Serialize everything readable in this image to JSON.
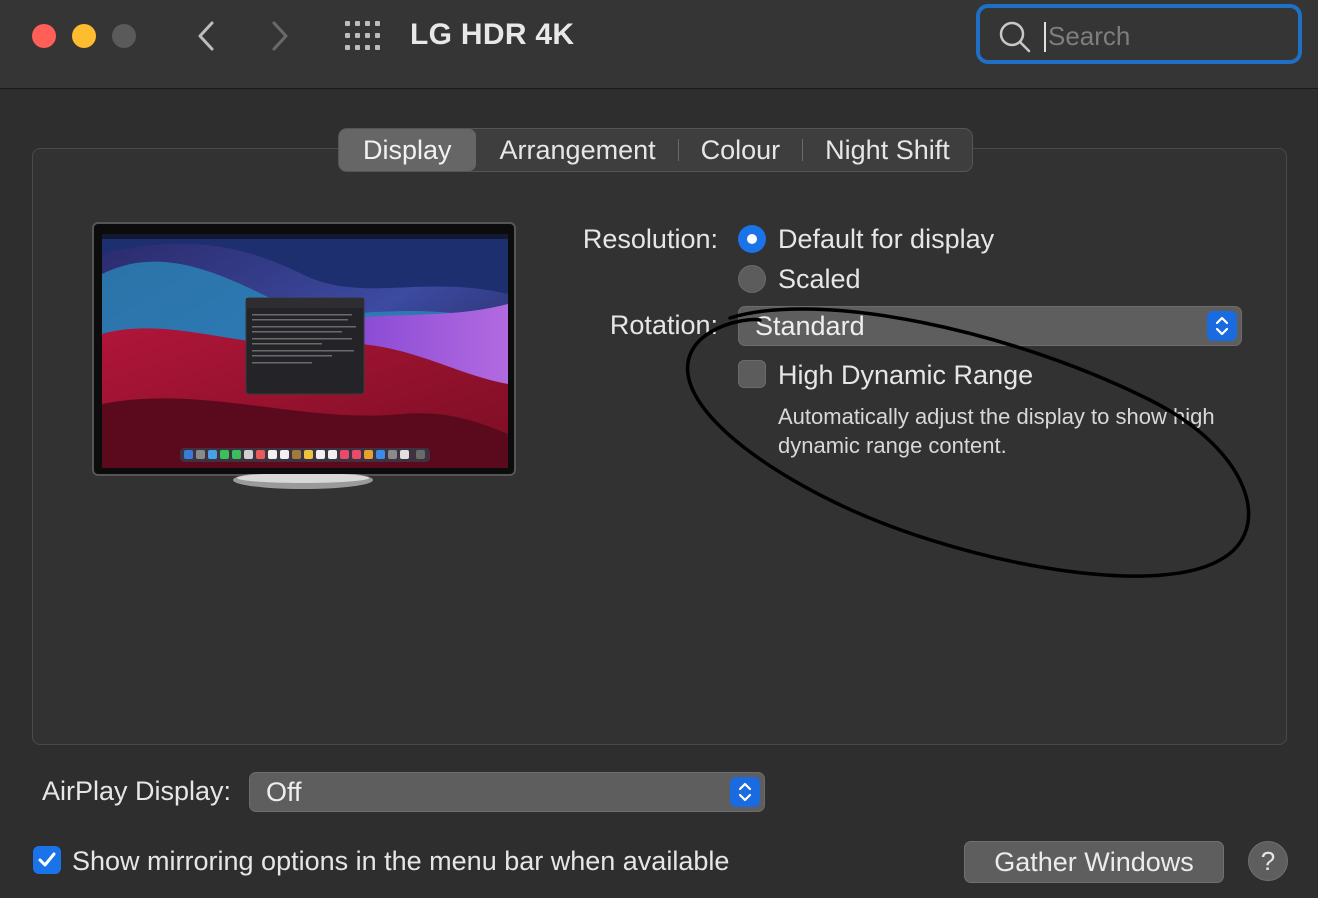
{
  "window": {
    "title": "LG HDR 4K",
    "search_placeholder": "Search"
  },
  "tabs": [
    {
      "label": "Display",
      "active": true
    },
    {
      "label": "Arrangement",
      "active": false
    },
    {
      "label": "Colour",
      "active": false
    },
    {
      "label": "Night Shift",
      "active": false
    }
  ],
  "resolution": {
    "label": "Resolution:",
    "options": [
      {
        "label": "Default for display",
        "selected": true
      },
      {
        "label": "Scaled",
        "selected": false
      }
    ]
  },
  "rotation": {
    "label": "Rotation:",
    "value": "Standard"
  },
  "hdr": {
    "label": "High Dynamic Range",
    "checked": false,
    "description": "Automatically adjust the display to show high dynamic range content."
  },
  "airplay": {
    "label": "AirPlay Display:",
    "value": "Off"
  },
  "mirroring": {
    "label": "Show mirroring options in the menu bar when available",
    "checked": true
  },
  "buttons": {
    "gather": "Gather Windows",
    "help": "?"
  },
  "colors": {
    "accent": "#1a73e8",
    "focus_ring": "#1f6fc4",
    "close": "#ff5f57",
    "minimize": "#febc2e"
  }
}
